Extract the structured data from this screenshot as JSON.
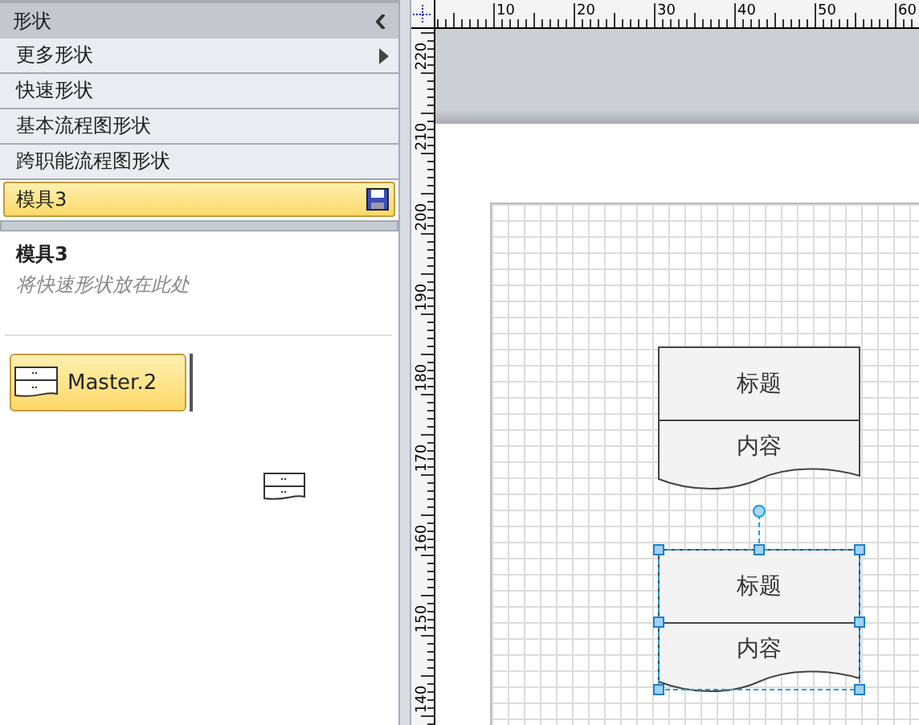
{
  "panel": {
    "title": "形状"
  },
  "menu_items": [
    {
      "label": "更多形状",
      "kind": "submenu",
      "selected": false
    },
    {
      "label": "快速形状",
      "kind": "stencil",
      "selected": false
    },
    {
      "label": "基本流程图形状",
      "kind": "stencil",
      "selected": false
    },
    {
      "label": "跨职能流程图形状",
      "kind": "stencil",
      "selected": false
    },
    {
      "label": "模具3",
      "kind": "stencil",
      "selected": true
    }
  ],
  "stencil": {
    "title": "模具3",
    "hint": "将快速形状放在此处",
    "masters": [
      {
        "label": "Master.2",
        "selected": true
      }
    ]
  },
  "rulers": {
    "horizontal": [
      "10",
      "20",
      "30",
      "40",
      "50",
      "60"
    ],
    "vertical": [
      "220",
      "210",
      "200",
      "190",
      "180",
      "170",
      "160",
      "150",
      "140"
    ]
  },
  "shapes": [
    {
      "title": "标题",
      "content": "内容",
      "selected": false
    },
    {
      "title": "标题",
      "content": "内容",
      "selected": true
    }
  ]
}
